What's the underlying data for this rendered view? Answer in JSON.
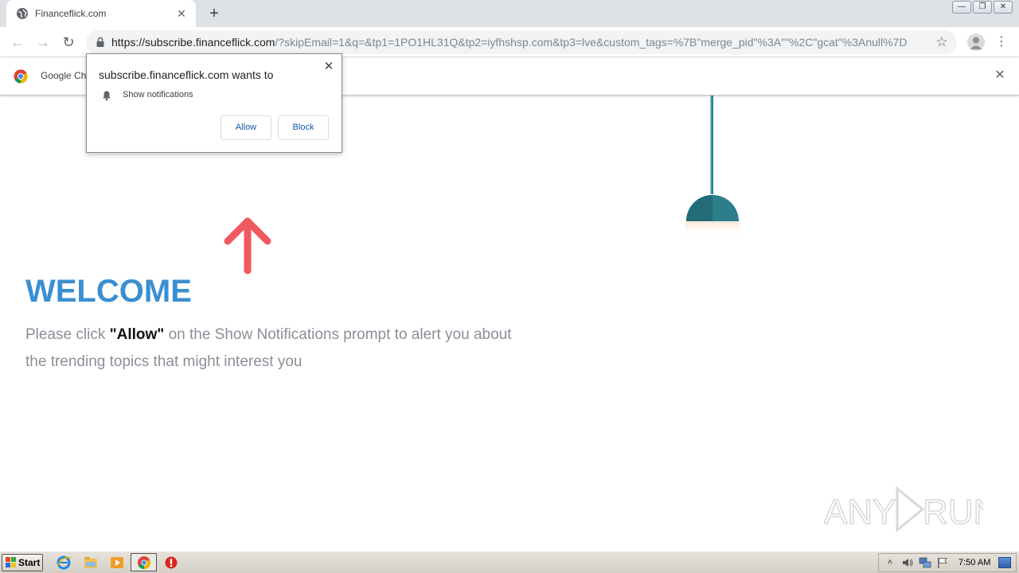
{
  "tab": {
    "title": "Financeflick.com",
    "close": "✕"
  },
  "new_tab": "+",
  "window_controls": {
    "minimize": "—",
    "restore": "❐",
    "close": "✕"
  },
  "nav": {
    "back": "←",
    "forward": "→",
    "reload": "↻"
  },
  "address": {
    "host": "https://subscribe.financeflick.com",
    "path": "/?skipEmail=1&q=&tp1=1PO1HL31Q&tp2=iyfhshsp.com&tp3=lve&custom_tags=%7B\"merge_pid\"%3A\"\"%2C\"gcat\"%3Anull%7D"
  },
  "icons": {
    "star": "☆",
    "menu": "⋮",
    "infobar_close": "✕",
    "popup_close": "✕"
  },
  "infobar": {
    "text": "Google Ch"
  },
  "popup": {
    "title": "subscribe.financeflick.com wants to",
    "permission": "Show notifications",
    "allow": "Allow",
    "block": "Block"
  },
  "page": {
    "heading": "WELCOME",
    "message_pre": "Please click ",
    "message_bold": "\"Allow\"",
    "message_post": " on the Show Notifications prompt to alert you about the trending topics that might interest you"
  },
  "watermark": {
    "text_left": "ANY",
    "text_right": "RUN"
  },
  "taskbar": {
    "start": "Start",
    "clock": "7:50 AM",
    "tray_arrow": "˄"
  },
  "colors": {
    "heading": "#3a8fd1",
    "arrow": "#f05a5f",
    "lamp": "#2d7e8d"
  }
}
